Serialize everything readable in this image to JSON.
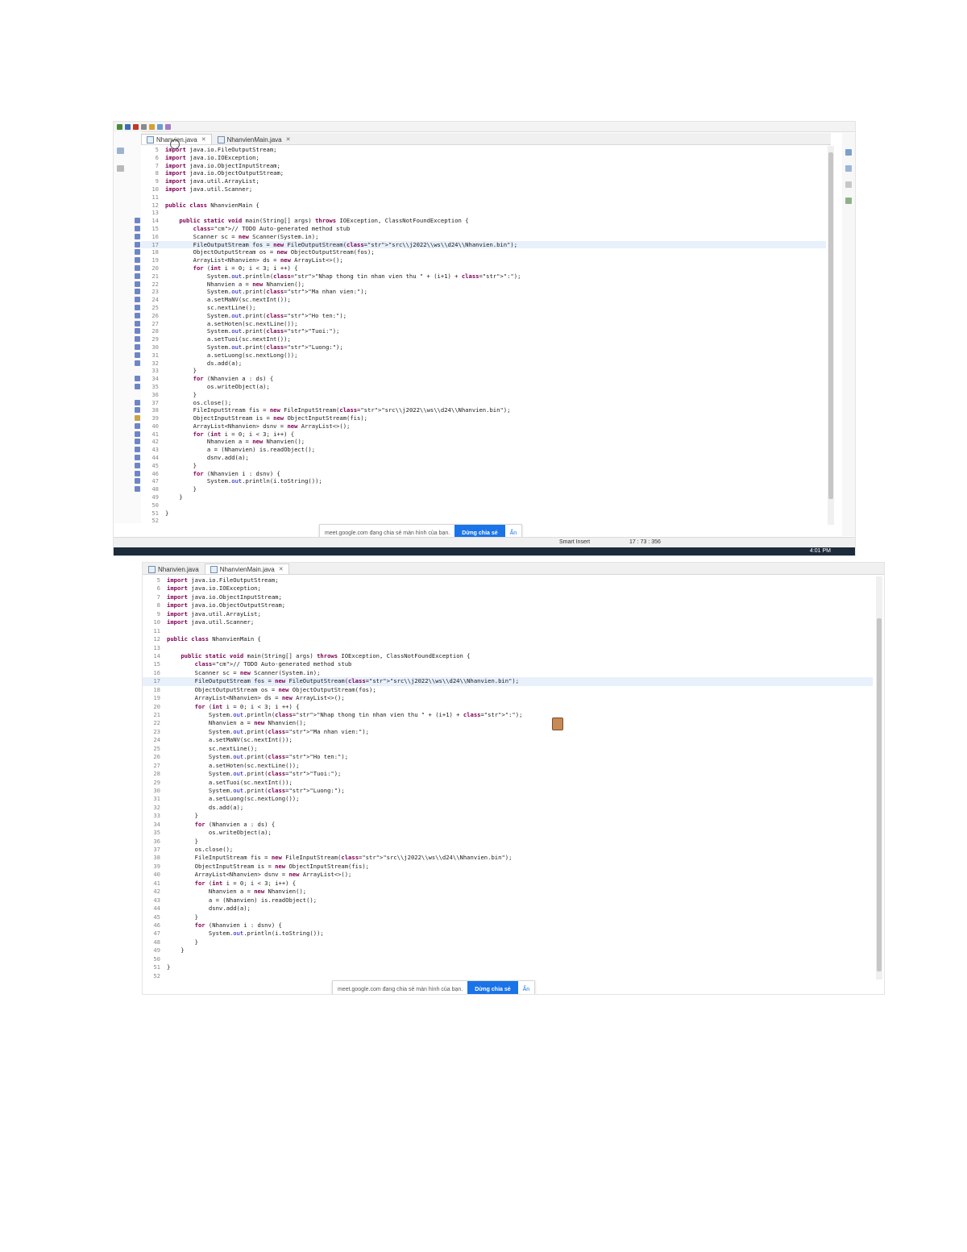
{
  "shot1": {
    "tabs": [
      {
        "label": "Nhanvien.java",
        "active": true
      },
      {
        "label": "NhanvienMain.java",
        "active": false
      }
    ],
    "toast": {
      "message": "meet.google.com đang chia sẻ màn hình của bạn.",
      "button": "Dừng chia sẻ",
      "hide": "Ẩn"
    },
    "status": {
      "insert_mode": "Smart Insert",
      "position": "17 : 73 : 356"
    },
    "taskbar_time": "4:01 PM"
  },
  "shot2": {
    "tabs": [
      {
        "label": "Nhanvien.java",
        "active": false
      },
      {
        "label": "NhanvienMain.java",
        "active": true
      }
    ],
    "toast": {
      "message": "meet.google.com đang chia sẻ màn hình của bạn.",
      "button": "Dừng chia sẻ",
      "hide": "Ẩn"
    }
  },
  "code_lines": [
    {
      "n": "5",
      "text": "import java.io.FileOutputStream;"
    },
    {
      "n": "6",
      "text": "import java.io.IOException;"
    },
    {
      "n": "7",
      "text": "import java.io.ObjectInputStream;"
    },
    {
      "n": "8",
      "text": "import java.io.ObjectOutputStream;"
    },
    {
      "n": "9",
      "text": "import java.util.ArrayList;"
    },
    {
      "n": "10",
      "text": "import java.util.Scanner;"
    },
    {
      "n": "11",
      "text": ""
    },
    {
      "n": "12",
      "text": "public class NhanvienMain {"
    },
    {
      "n": "13",
      "text": ""
    },
    {
      "n": "14",
      "text": "    public static void main(String[] args) throws IOException, ClassNotFoundException {"
    },
    {
      "n": "15",
      "text": "        // TODO Auto-generated method stub"
    },
    {
      "n": "16",
      "text": "        Scanner sc = new Scanner(System.in);"
    },
    {
      "n": "17",
      "text": "        FileOutputStream fos = new FileOutputStream(\"src\\\\j2022\\\\ws\\\\d24\\\\Nhanvien.bin\");"
    },
    {
      "n": "18",
      "text": "        ObjectOutputStream os = new ObjectOutputStream(fos);"
    },
    {
      "n": "19",
      "text": "        ArrayList<Nhanvien> ds = new ArrayList<>();"
    },
    {
      "n": "20",
      "text": "        for (int i = 0; i < 3; i ++) {"
    },
    {
      "n": "21",
      "text": "            System.out.println(\"Nhap thong tin nhan vien thu \" + (i+1) + \":\");"
    },
    {
      "n": "22",
      "text": "            Nhanvien a = new Nhanvien();"
    },
    {
      "n": "23",
      "text": "            System.out.print(\"Ma nhan vien:\");"
    },
    {
      "n": "24",
      "text": "            a.setMaNV(sc.nextInt());"
    },
    {
      "n": "25",
      "text": "            sc.nextLine();"
    },
    {
      "n": "26",
      "text": "            System.out.print(\"Ho ten:\");"
    },
    {
      "n": "27",
      "text": "            a.setHoten(sc.nextLine());"
    },
    {
      "n": "28",
      "text": "            System.out.print(\"Tuoi:\");"
    },
    {
      "n": "29",
      "text": "            a.setTuoi(sc.nextInt());"
    },
    {
      "n": "30",
      "text": "            System.out.print(\"Luong:\");"
    },
    {
      "n": "31",
      "text": "            a.setLuong(sc.nextLong());"
    },
    {
      "n": "32",
      "text": "            ds.add(a);"
    },
    {
      "n": "33",
      "text": "        }"
    },
    {
      "n": "34",
      "text": "        for (Nhanvien a : ds) {"
    },
    {
      "n": "35",
      "text": "            os.writeObject(a);"
    },
    {
      "n": "36",
      "text": "        }"
    },
    {
      "n": "37",
      "text": "        os.close();"
    },
    {
      "n": "38",
      "text": "        FileInputStream fis = new FileInputStream(\"src\\\\j2022\\\\ws\\\\d24\\\\Nhanvien.bin\");"
    },
    {
      "n": "39",
      "text": "        ObjectInputStream is = new ObjectInputStream(fis);"
    },
    {
      "n": "40",
      "text": "        ArrayList<Nhanvien> dsnv = new ArrayList<>();"
    },
    {
      "n": "41",
      "text": "        for (int i = 0; i < 3; i++) {"
    },
    {
      "n": "42",
      "text": "            Nhanvien a = new Nhanvien();"
    },
    {
      "n": "43",
      "text": "            a = (Nhanvien) is.readObject();"
    },
    {
      "n": "44",
      "text": "            dsnv.add(a);"
    },
    {
      "n": "45",
      "text": "        }"
    },
    {
      "n": "46",
      "text": "        for (Nhanvien i : dsnv) {"
    },
    {
      "n": "47",
      "text": "            System.out.println(i.toString());"
    },
    {
      "n": "48",
      "text": "        }"
    },
    {
      "n": "49",
      "text": "    }"
    },
    {
      "n": "50",
      "text": ""
    },
    {
      "n": "51",
      "text": "}"
    },
    {
      "n": "52",
      "text": ""
    }
  ]
}
